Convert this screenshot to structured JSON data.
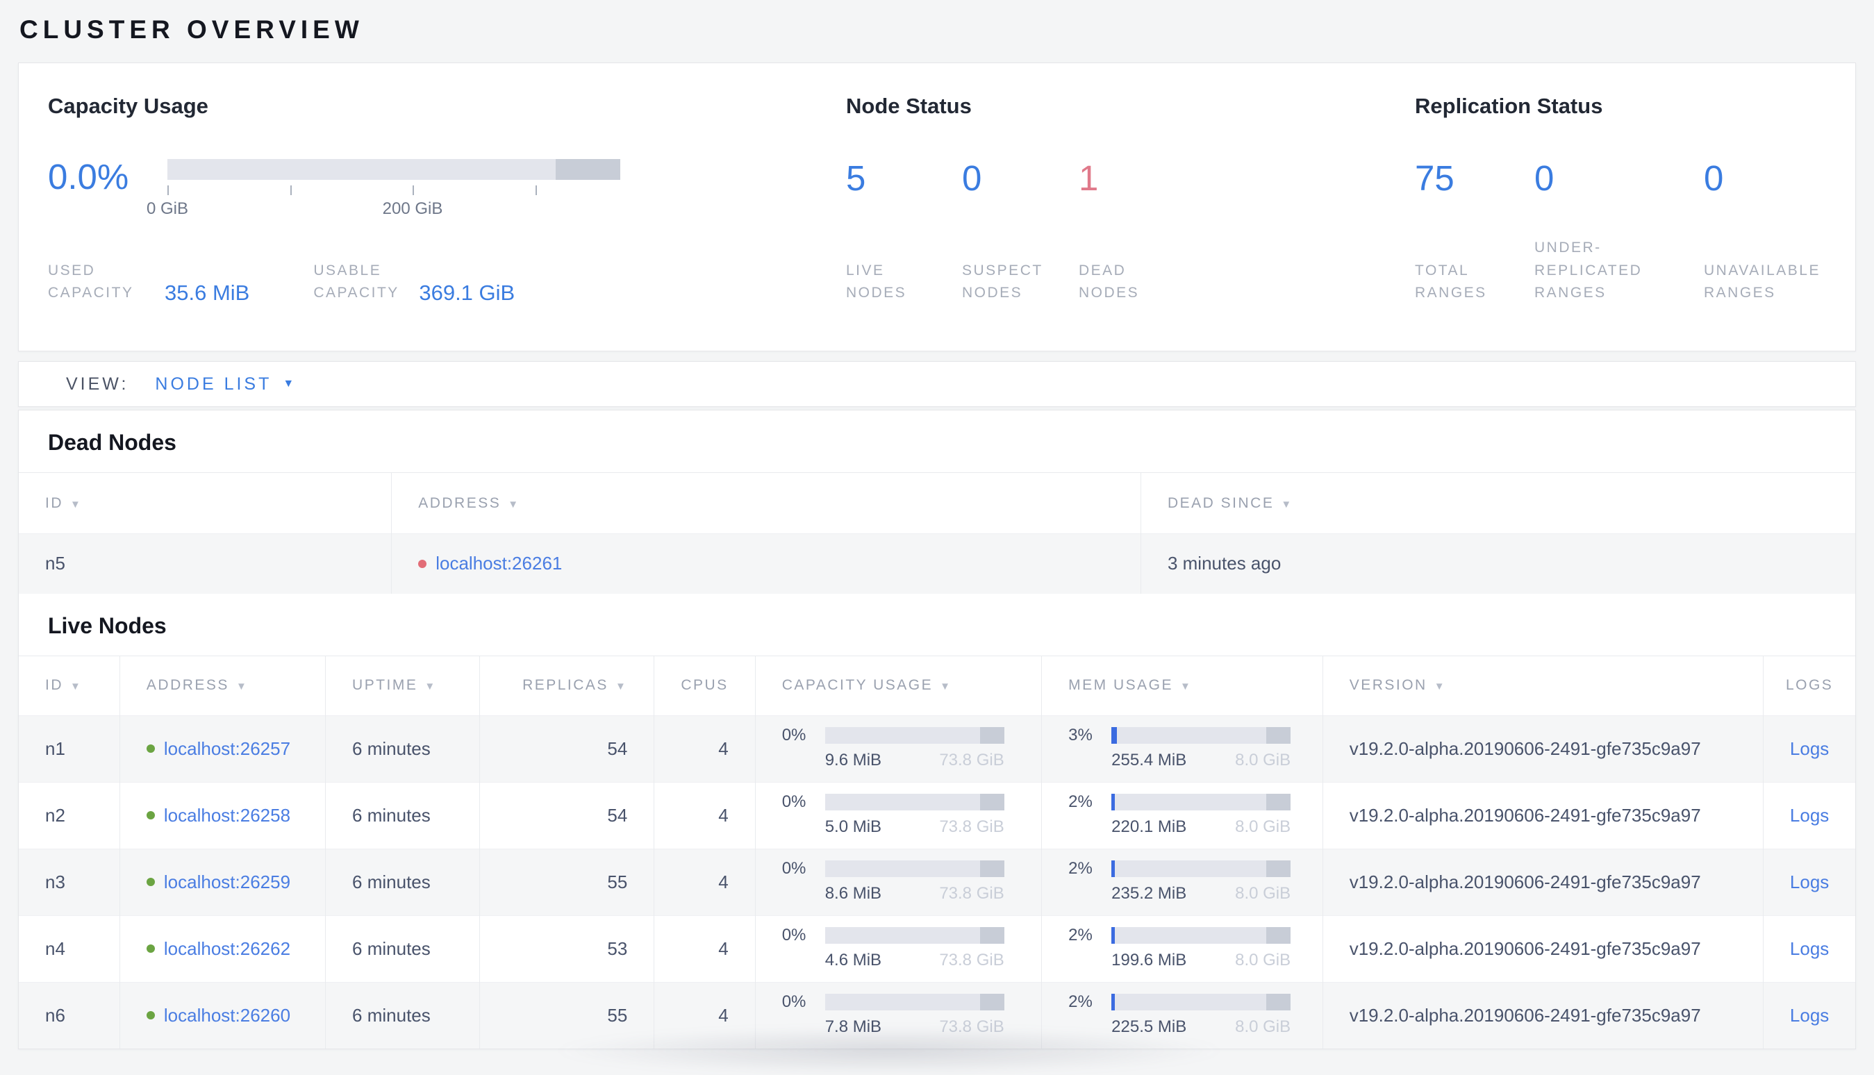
{
  "page_title": "CLUSTER OVERVIEW",
  "icons": {
    "sort_desc": "▼",
    "dropdown_caret": "▼"
  },
  "summary": {
    "capacity": {
      "title": "Capacity Usage",
      "percent": "0.0%",
      "tick_label_zero": "0 GiB",
      "tick_label_mid": "200 GiB",
      "used_label": "USED CAPACITY",
      "used_value": "35.6 MiB",
      "usable_label": "USABLE CAPACITY",
      "usable_value": "369.1 GiB"
    },
    "node_status": {
      "title": "Node Status",
      "stats": [
        {
          "value": "5",
          "label": "LIVE NODES"
        },
        {
          "value": "0",
          "label": "SUSPECT NODES"
        },
        {
          "value": "1",
          "label": "DEAD NODES"
        }
      ]
    },
    "replication": {
      "title": "Replication Status",
      "stats": [
        {
          "value": "75",
          "label": "TOTAL RANGES"
        },
        {
          "value": "0",
          "label": "UNDER-REPLICATED RANGES"
        },
        {
          "value": "0",
          "label": "UNAVAILABLE RANGES"
        }
      ]
    }
  },
  "view_bar": {
    "label": "VIEW:",
    "selected": "NODE LIST"
  },
  "dead_nodes": {
    "heading": "Dead Nodes",
    "columns": {
      "id": "ID",
      "address": "ADDRESS",
      "dead_since": "DEAD SINCE"
    },
    "rows": [
      {
        "id": "n5",
        "address": "localhost:26261",
        "dead_since": "3 minutes ago"
      }
    ]
  },
  "live_nodes": {
    "heading": "Live Nodes",
    "columns": {
      "id": "ID",
      "address": "ADDRESS",
      "uptime": "UPTIME",
      "replicas": "REPLICAS",
      "cpus": "CPUS",
      "capacity": "CAPACITY USAGE",
      "mem": "MEM USAGE",
      "version": "VERSION",
      "logs": "LOGS"
    },
    "rows": [
      {
        "id": "n1",
        "address": "localhost:26257",
        "uptime": "6 minutes",
        "replicas": "54",
        "cpus": "4",
        "capacity_pct": "0%",
        "capacity_fill": 0,
        "capacity_used": "9.6 MiB",
        "capacity_total": "73.8 GiB",
        "mem_pct": "3%",
        "mem_fill": 3,
        "mem_used": "255.4 MiB",
        "mem_total": "8.0 GiB",
        "version": "v19.2.0-alpha.20190606-2491-gfe735c9a97",
        "logs_label": "Logs"
      },
      {
        "id": "n2",
        "address": "localhost:26258",
        "uptime": "6 minutes",
        "replicas": "54",
        "cpus": "4",
        "capacity_pct": "0%",
        "capacity_fill": 0,
        "capacity_used": "5.0 MiB",
        "capacity_total": "73.8 GiB",
        "mem_pct": "2%",
        "mem_fill": 2,
        "mem_used": "220.1 MiB",
        "mem_total": "8.0 GiB",
        "version": "v19.2.0-alpha.20190606-2491-gfe735c9a97",
        "logs_label": "Logs"
      },
      {
        "id": "n3",
        "address": "localhost:26259",
        "uptime": "6 minutes",
        "replicas": "55",
        "cpus": "4",
        "capacity_pct": "0%",
        "capacity_fill": 0,
        "capacity_used": "8.6 MiB",
        "capacity_total": "73.8 GiB",
        "mem_pct": "2%",
        "mem_fill": 2,
        "mem_used": "235.2 MiB",
        "mem_total": "8.0 GiB",
        "version": "v19.2.0-alpha.20190606-2491-gfe735c9a97",
        "logs_label": "Logs"
      },
      {
        "id": "n4",
        "address": "localhost:26262",
        "uptime": "6 minutes",
        "replicas": "53",
        "cpus": "4",
        "capacity_pct": "0%",
        "capacity_fill": 0,
        "capacity_used": "4.6 MiB",
        "capacity_total": "73.8 GiB",
        "mem_pct": "2%",
        "mem_fill": 2,
        "mem_used": "199.6 MiB",
        "mem_total": "8.0 GiB",
        "version": "v19.2.0-alpha.20190606-2491-gfe735c9a97",
        "logs_label": "Logs"
      },
      {
        "id": "n6",
        "address": "localhost:26260",
        "uptime": "6 minutes",
        "replicas": "55",
        "cpus": "4",
        "capacity_pct": "0%",
        "capacity_fill": 0,
        "capacity_used": "7.8 MiB",
        "capacity_total": "73.8 GiB",
        "mem_pct": "2%",
        "mem_fill": 2,
        "mem_used": "225.5 MiB",
        "mem_total": "8.0 GiB",
        "version": "v19.2.0-alpha.20190606-2491-gfe735c9a97",
        "logs_label": "Logs"
      }
    ]
  },
  "colors": {
    "accent_blue": "#3a7ce0",
    "link_blue": "#4a7de2",
    "danger_red": "#e0798a",
    "live_green": "#6ba442",
    "dead_red": "#e26d77",
    "bar_light": "#e3e5ec",
    "bar_dark": "#c8cdd7",
    "page_bg": "#f4f5f6"
  }
}
